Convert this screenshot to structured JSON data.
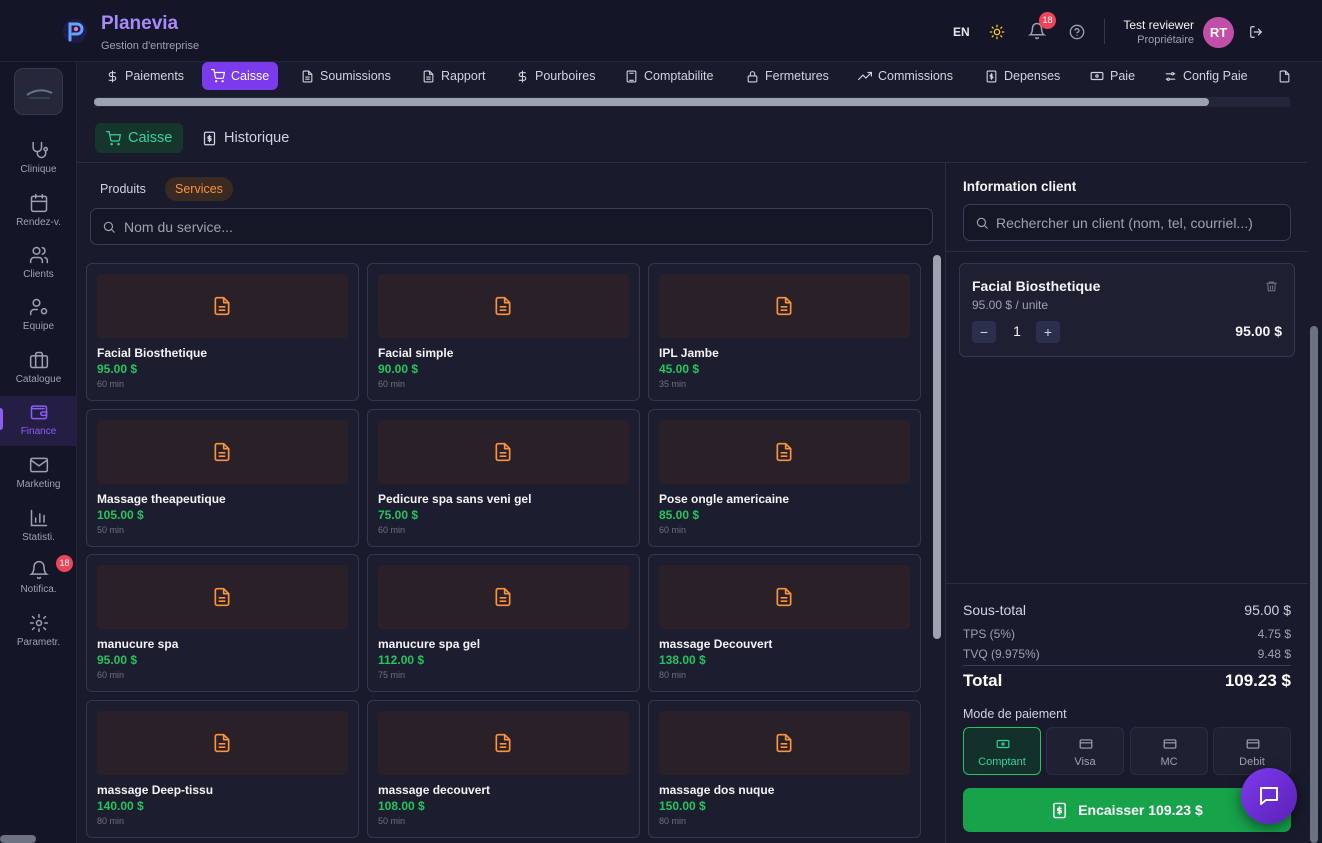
{
  "header": {
    "brand": "Planevia",
    "brand_subtitle": "Gestion d'entreprise",
    "language": "EN",
    "notifications_count": "18",
    "user_name": "Test reviewer",
    "user_role": "Propriétaire",
    "user_initials": "RT"
  },
  "sidebar": {
    "items": [
      {
        "label": "Clinique",
        "icon": "stethoscope-icon"
      },
      {
        "label": "Rendez-v.",
        "icon": "calendar-icon"
      },
      {
        "label": "Clients",
        "icon": "users-icon"
      },
      {
        "label": "Equipe",
        "icon": "user-gear-icon"
      },
      {
        "label": "Catalogue",
        "icon": "briefcase-icon"
      },
      {
        "label": "Finance",
        "icon": "wallet-icon"
      },
      {
        "label": "Marketing",
        "icon": "mail-icon"
      },
      {
        "label": "Statisti.",
        "icon": "bar-chart-icon"
      },
      {
        "label": "Notifica.",
        "icon": "bell-icon"
      },
      {
        "label": "Parametr.",
        "icon": "gear-icon"
      }
    ],
    "notifications_badge": "18"
  },
  "tabs": [
    {
      "label": "Paiements",
      "icon": "dollar-icon"
    },
    {
      "label": "Caisse",
      "icon": "cart-icon"
    },
    {
      "label": "Soumissions",
      "icon": "document-icon"
    },
    {
      "label": "Rapport",
      "icon": "document-icon"
    },
    {
      "label": "Pourboires",
      "icon": "dollar-icon"
    },
    {
      "label": "Comptabilite",
      "icon": "calculator-icon"
    },
    {
      "label": "Fermetures",
      "icon": "lock-icon"
    },
    {
      "label": "Commissions",
      "icon": "trend-icon"
    },
    {
      "label": "Depenses",
      "icon": "receipt-icon"
    },
    {
      "label": "Paie",
      "icon": "banknote-icon"
    },
    {
      "label": "Config Paie",
      "icon": "sliders-icon"
    }
  ],
  "subtabs": {
    "caisse": "Caisse",
    "historique": "Historique"
  },
  "catalog": {
    "filters": {
      "produits": "Produits",
      "services": "Services"
    },
    "search_placeholder": "Nom du service...",
    "services": [
      {
        "name": "Facial Biosthetique",
        "price": "95.00 $",
        "duration": "60 min"
      },
      {
        "name": "Facial simple",
        "price": "90.00 $",
        "duration": "60 min"
      },
      {
        "name": "IPL Jambe",
        "price": "45.00 $",
        "duration": "35 min"
      },
      {
        "name": "Massage theapeutique",
        "price": "105.00 $",
        "duration": "50 min"
      },
      {
        "name": "Pedicure spa sans veni gel",
        "price": "75.00 $",
        "duration": "60 min"
      },
      {
        "name": "Pose ongle americaine",
        "price": "85.00 $",
        "duration": "60 min"
      },
      {
        "name": "manucure spa",
        "price": "95.00 $",
        "duration": "60 min"
      },
      {
        "name": "manucure spa gel",
        "price": "112.00 $",
        "duration": "75 min"
      },
      {
        "name": "massage Decouvert",
        "price": "138.00 $",
        "duration": "80 min"
      },
      {
        "name": "massage Deep-tissu",
        "price": "140.00 $",
        "duration": "80 min"
      },
      {
        "name": "massage decouvert",
        "price": "108.00 $",
        "duration": "50 min"
      },
      {
        "name": "massage dos nuque",
        "price": "150.00 $",
        "duration": "80 min"
      }
    ]
  },
  "client": {
    "title": "Information client",
    "search_placeholder": "Rechercher un client (nom, tel, courriel...)"
  },
  "cart": {
    "items": [
      {
        "name": "Facial Biosthetique",
        "unit_price": "95.00 $ / unite",
        "quantity": "1",
        "total": "95.00 $"
      }
    ],
    "decrement": "−",
    "increment": "+"
  },
  "totals": {
    "subtotal_label": "Sous-total",
    "subtotal": "95.00 $",
    "tps_label": "TPS (5%)",
    "tps": "4.75 $",
    "tvq_label": "TVQ (9.975%)",
    "tvq": "9.48 $",
    "total_label": "Total",
    "total": "109.23 $"
  },
  "payment": {
    "label": "Mode de paiement",
    "methods": [
      "Comptant",
      "Visa",
      "MC",
      "Debit"
    ],
    "pay_button": "Encaisser 109.23 $"
  },
  "colors": {
    "accent": "#7c3aed",
    "success": "#22c55e",
    "warning": "#fb923c",
    "badge": "#ef4458"
  }
}
